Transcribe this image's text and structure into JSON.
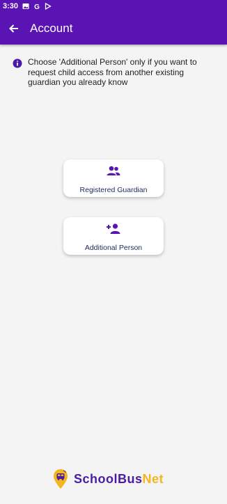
{
  "status_bar": {
    "time": "3:30",
    "icons": [
      "image-icon",
      "google-icon",
      "play-store-icon"
    ]
  },
  "appbar": {
    "title": "Account",
    "back_icon": "arrow-left-icon"
  },
  "info": {
    "icon": "info-circle-icon",
    "text": "Choose 'Additional Person' only if you want to request child access from another existing guardian you already know"
  },
  "options": [
    {
      "label": "Registered Guardian",
      "icon": "group-people-icon"
    },
    {
      "label": "Additional Person",
      "icon": "add-person-icon"
    }
  ],
  "brand": {
    "part1": "SchoolBus",
    "part2": "Net",
    "logo_icon": "schoolbus-pin-logo"
  },
  "colors": {
    "primary": "#5a14b4",
    "brand_accent": "#f3b61f",
    "background": "#f4f4f4",
    "card_text": "#1c2a5a"
  }
}
